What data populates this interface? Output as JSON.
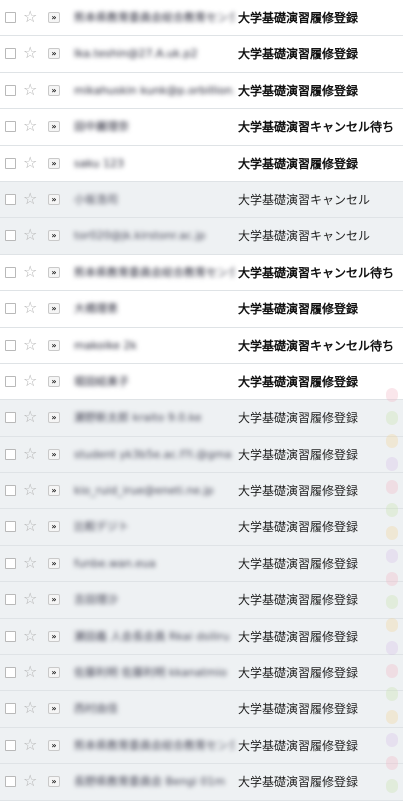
{
  "icons": {
    "checkbox": "checkbox-icon",
    "star": "☆",
    "importance": "»"
  },
  "messages": [
    {
      "sender": "熊本県教育委員会総合教育センター",
      "subject": "大学基礎演習履修登録",
      "unread": true
    },
    {
      "sender": "Ika.teshin@27.A.uk.p2",
      "subject": "大学基礎演習履修登録",
      "unread": true
    },
    {
      "sender": "mikahuskin kunk@p.orbillion.ac",
      "subject": "大学基礎演習履修登録",
      "unread": true
    },
    {
      "sender": "田中麗理奈",
      "subject": "大学基礎演習キャンセル待ち",
      "unread": true
    },
    {
      "sender": "saku 123",
      "subject": "大学基礎演習履修登録",
      "unread": true
    },
    {
      "sender": "小坂浩司",
      "subject": "大学基礎演習キャンセル",
      "unread": false
    },
    {
      "sender": "tor020@jk.kirstonr.ac.jp",
      "subject": "大学基礎演習キャンセル",
      "unread": false
    },
    {
      "sender": "熊本県教育委員会総合教育センター",
      "subject": "大学基礎演習キャンセル待ち",
      "unread": true
    },
    {
      "sender": "大橋理恵",
      "subject": "大学基礎演習履修登録",
      "unread": true
    },
    {
      "sender": "makoike 2k",
      "subject": "大学基礎演習キャンセル待ち",
      "unread": true
    },
    {
      "sender": "堀田結美子",
      "subject": "大学基礎演習履修登録",
      "unread": true
    },
    {
      "sender": "瀬野新太郎 kraito 9.0.ke",
      "subject": "大学基礎演習履修登録",
      "unread": false
    },
    {
      "sender": "student yk3b5e.ac.f?l.@gma",
      "subject": "大学基礎演習履修登録",
      "unread": false
    },
    {
      "sender": "kio_ruid_irue@eneti.ne.jp",
      "subject": "大学基礎演習履修登録",
      "unread": false
    },
    {
      "sender": "比較デジト",
      "subject": "大学基礎演習履修登録",
      "unread": false
    },
    {
      "sender": "funbe.wan.eua",
      "subject": "大学基礎演習履修登録",
      "unread": false
    },
    {
      "sender": "吉田理沙",
      "subject": "大学基礎演習履修登録",
      "unread": false
    },
    {
      "sender": "瀬田義 人会長会員 Rkai dsiliru",
      "subject": "大学基礎演習履修登録",
      "unread": false
    },
    {
      "sender": "佐藤利明 佐藤利明 kkanatmio",
      "subject": "大学基礎演習履修登録",
      "unread": false
    },
    {
      "sender": "西村由佳",
      "subject": "大学基礎演習履修登録",
      "unread": false
    },
    {
      "sender": "熊本県教育委員会総合教育センター",
      "subject": "大学基礎演習履修登録",
      "unread": false
    },
    {
      "sender": "長野県教育委員会 Bengi 01m",
      "subject": "大学基礎演習履修登録",
      "unread": false
    }
  ]
}
